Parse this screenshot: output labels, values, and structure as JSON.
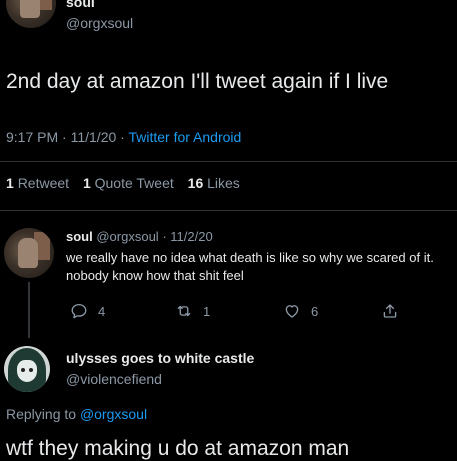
{
  "main_tweet": {
    "display_name": "soul",
    "handle": "@orgxsoul",
    "text": "2nd day at amazon I'll tweet again if I live",
    "time": "9:17 PM",
    "sep1": "·",
    "date": "11/1/20",
    "sep2": "·",
    "source": "Twitter for Android",
    "stats": {
      "retweets_count": "1",
      "retweets_label": "Retweet",
      "quotes_count": "1",
      "quotes_label": "Quote Tweet",
      "likes_count": "16",
      "likes_label": "Likes"
    }
  },
  "reply": {
    "display_name": "soul",
    "handle": "@orgxsoul",
    "sep": "·",
    "date": "11/2/20",
    "text": "we really have no idea what death is like so why we scared of it. nobody know how that shit feel",
    "actions": {
      "comment_count": "4",
      "retweet_count": "1",
      "like_count": "6"
    }
  },
  "reply2": {
    "display_name": "ulysses goes to white castle",
    "handle": "@violencefiend",
    "replying_label": "Replying to",
    "replying_mention": "@orgxsoul",
    "text": "wtf they making u do at amazon man"
  },
  "colors": {
    "background": "#000000",
    "text": "#e7e9ea",
    "muted": "#8b98a5",
    "accent": "#1d9bf0"
  },
  "icons": [
    "comment-icon",
    "retweet-icon",
    "like-icon",
    "share-icon"
  ]
}
